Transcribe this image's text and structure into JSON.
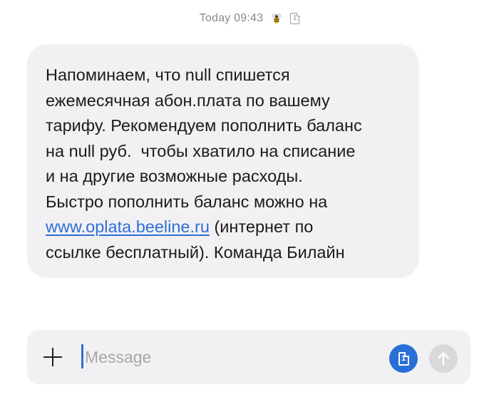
{
  "header": {
    "timestamp": "Today 09:43",
    "bee_icon": "bee-icon",
    "sim_icon": "sim-card-icon",
    "sim_number": "1"
  },
  "message": {
    "lines": [
      "Напоминаем, что null спишется",
      "ежемесячная абон.плата по вашему",
      "тарифу. Рекомендуем пополнить баланс",
      "на null руб.  чтобы хватило на списание",
      "и на другие возможные расходы.",
      "Быстро пополнить баланс можно на"
    ],
    "link_text": "www.oplata.beeline.ru",
    "after_link": " (интернет по",
    "last_line": "ссылке бесплатный). Команда Билайн",
    "link_color": "#2f6fd6"
  },
  "composer": {
    "add_icon": "plus-icon",
    "placeholder": "Message",
    "value": "",
    "sim_button_icon": "sim-card-icon",
    "sim_button_number": "1",
    "sim_button_color": "#2a6fd8",
    "send_icon": "send-arrow-icon"
  }
}
